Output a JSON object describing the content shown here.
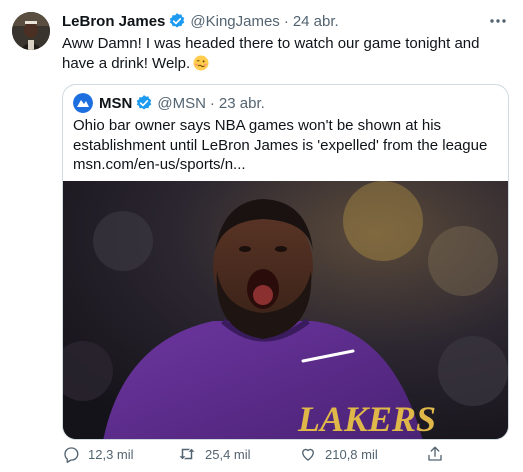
{
  "tweet": {
    "author_name": "LeBron James",
    "author_handle": "@KingJames",
    "timestamp": "24 abr.",
    "text": "Aww Damn! I was headed there to watch our game tonight and have a drink! Welp.",
    "icons": {
      "verified": "verified-badge-icon",
      "more": "more-options-icon",
      "emoji": "woozy-face-emoji"
    }
  },
  "quote": {
    "author_name": "MSN",
    "author_handle": "@MSN",
    "timestamp": "23 abr.",
    "text": "Ohio bar owner says NBA games won't be shown at his establishment until LeBron James is 'expelled' from the league msn.com/en-us/sports/n...",
    "image_jersey_text": "LAKERS"
  },
  "actions": {
    "reply_count": "12,3 mil",
    "retweet_count": "25,4 mil",
    "like_count": "210,8 mil"
  },
  "colors": {
    "accent": "#1d9bf0",
    "secondary_text": "#536471",
    "border": "#cfd9de",
    "jersey": "#5b2a86"
  }
}
